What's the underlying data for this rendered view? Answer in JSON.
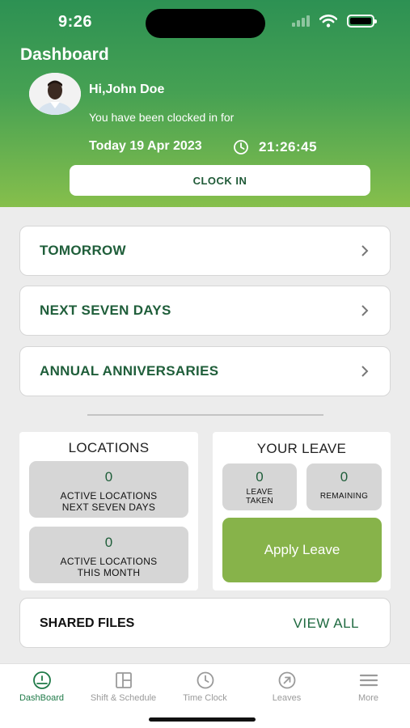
{
  "status_bar": {
    "time": "9:26"
  },
  "header": {
    "title": "Dashboard",
    "greeting": "Hi,John Doe",
    "clocked_text": "You have been clocked in for",
    "date": "Today 19 Apr 2023",
    "elapsed": "21:26:45",
    "clock_button": "CLOCK IN"
  },
  "sections": [
    {
      "label": "TOMORROW"
    },
    {
      "label": "NEXT SEVEN DAYS"
    },
    {
      "label": "ANNUAL ANNIVERSARIES"
    }
  ],
  "locations": {
    "title": "LOCATIONS",
    "next_seven_days": {
      "value": "0",
      "label_line1": "ACTIVE LOCATIONS",
      "label_line2": "NEXT SEVEN DAYS"
    },
    "this_month": {
      "value": "0",
      "label_line1": "ACTIVE LOCATIONS",
      "label_line2": "THIS MONTH"
    }
  },
  "leave": {
    "title": "YOUR LEAVE",
    "taken": {
      "value": "0",
      "label_line1": "LEAVE",
      "label_line2": "TAKEN"
    },
    "remaining": {
      "value": "0",
      "label": "REMAINING"
    },
    "apply_button": "Apply Leave"
  },
  "shared_files": {
    "label": "SHARED FILES",
    "view_all": "VIEW ALL"
  },
  "tabs": [
    {
      "label": "DashBoard",
      "icon": "dashboard-icon",
      "active": true
    },
    {
      "label": "Shift & Schedule",
      "icon": "schedule-icon",
      "active": false
    },
    {
      "label": "Time Clock",
      "icon": "clock-icon",
      "active": false
    },
    {
      "label": "Leaves",
      "icon": "leaves-icon",
      "active": false
    },
    {
      "label": "More",
      "icon": "menu-icon",
      "active": false
    }
  ],
  "colors": {
    "brand_green": "#1f5e3a",
    "accent_green": "#87b34a",
    "header_top": "#2d9153",
    "header_bottom": "#86bf4c"
  }
}
